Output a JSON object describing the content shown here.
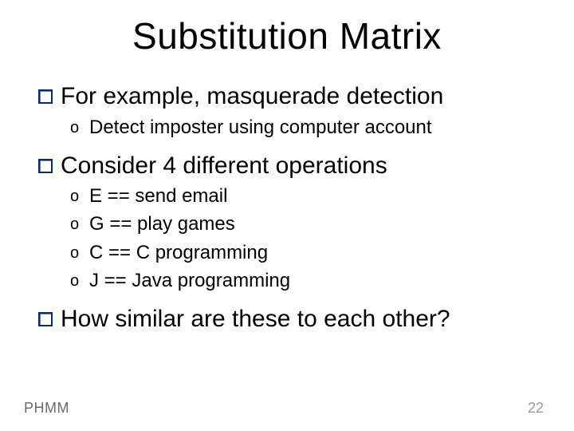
{
  "title": "Substitution Matrix",
  "bullets": [
    {
      "text": "For example, masquerade detection",
      "sub": [
        "Detect imposter using computer account"
      ]
    },
    {
      "text": "Consider 4 different operations",
      "sub": [
        "E == send email",
        "G == play games",
        "C == C programming",
        "J == Java programming"
      ]
    },
    {
      "text": "How similar are these to each other?",
      "sub": []
    }
  ],
  "footer_left": "PHMM",
  "footer_right": "22"
}
